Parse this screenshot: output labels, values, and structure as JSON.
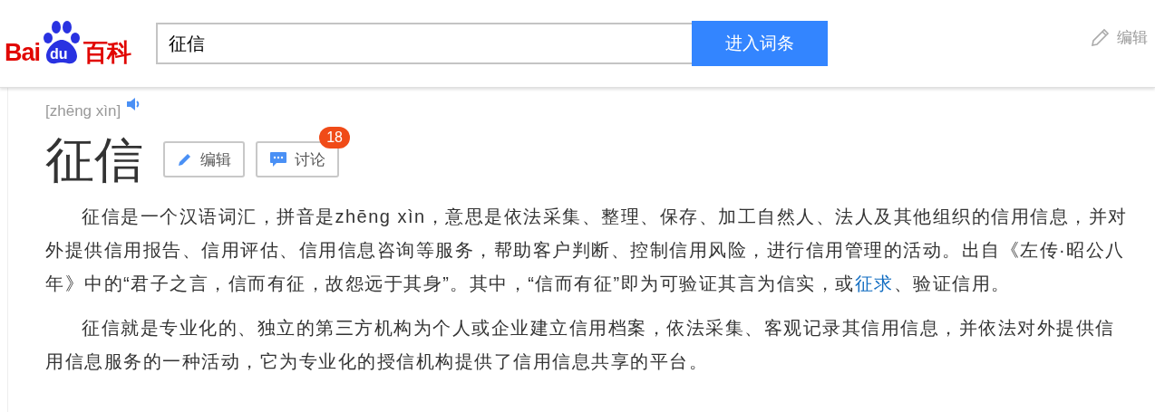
{
  "header": {
    "logo": {
      "left": "Bai",
      "paw": "du",
      "right": "百科"
    },
    "search": {
      "value": "征信"
    },
    "search_button": "进入词条",
    "edit_link": "编辑"
  },
  "entry": {
    "pinyin": "[zhēng xìn]",
    "title": "征信",
    "buttons": [
      {
        "kind": "edit",
        "label": "编辑"
      },
      {
        "kind": "discuss",
        "label": "讨论",
        "badge": "18"
      }
    ]
  },
  "paragraphs": [
    {
      "parts": [
        {
          "text": "征信是一个汉语词汇，拼音是zhēng xìn，意思是依法采集、整理、保存、加工自然人、法人及其他组织的信用信息，并对外提供信用报告、信用评估、信用信息咨询等服务，帮助客户判断、控制信用风险，进行信用管理的活动。出自《左传·昭公八年》中的“君子之言，信而有征，故怨远于其身”。其中，“信而有征”即为可验证其言为信实，或",
          "link": false
        },
        {
          "text": "征求",
          "link": true
        },
        {
          "text": "、验证信用。",
          "link": false
        }
      ]
    },
    {
      "parts": [
        {
          "text": "征信就是专业化的、独立的第三方机构为个人或企业建立信用档案，依法采集、客观记录其信用信息，并依法对外提供信用信息服务的一种活动，它为专业化的授信机构提供了信用信息共享的平台。",
          "link": false
        }
      ]
    }
  ]
}
